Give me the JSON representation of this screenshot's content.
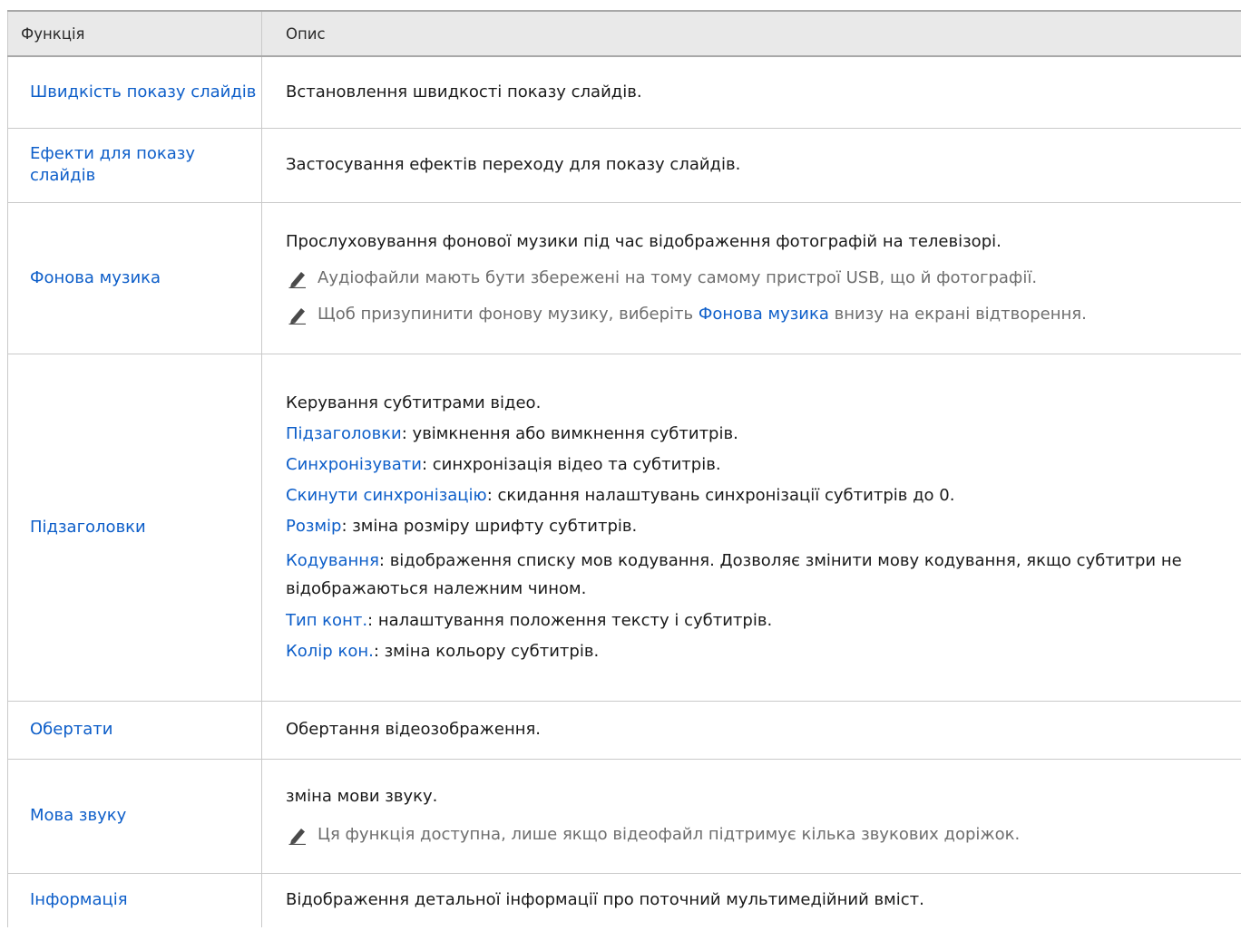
{
  "header": {
    "col_function": "Функція",
    "col_description": "Опис"
  },
  "rows": [
    {
      "function": "Швидкість показу слайдів",
      "desc": "Встановлення швидкості показу слайдів."
    },
    {
      "function": "Ефекти для показу слайдів",
      "desc": "Застосування ефектів переходу для показу слайдів."
    },
    {
      "function": "Фонова музика",
      "desc": "Прослуховування фонової музики під час відображення фотографій на телевізорі.",
      "note1": "Аудіофайли мають бути збережені на тому самому пристрої USB, що й фотографії.",
      "note2_before": "Щоб призупинити фонову музику, виберіть ",
      "note2_link": "Фонова музика",
      "note2_after": " внизу на екрані відтворення."
    },
    {
      "function": "Підзаголовки",
      "desc": "Керування субтитрами відео.",
      "items": [
        {
          "term": "Підзаголовки",
          "text": ": увімкнення або вимкнення субтитрів."
        },
        {
          "term": "Синхронізувати",
          "text": ": синхронізація відео та субтитрів."
        },
        {
          "term": "Скинути синхронізацію",
          "text": ": скидання налаштувань синхронізації субтитрів до 0."
        },
        {
          "term": "Розмір",
          "text": ": зміна розміру шрифту субтитрів."
        },
        {
          "term": "Кодування",
          "text": ": відображення списку мов кодування. Дозволяє змінити мову кодування, якщо субтитри не відображаються належним чином."
        },
        {
          "term": "Тип конт.",
          "text": ": налаштування положення тексту і субтитрів."
        },
        {
          "term": "Колір кон.",
          "text": ": зміна кольору субтитрів."
        }
      ]
    },
    {
      "function": "Обертати",
      "desc": "Обертання відеозображення."
    },
    {
      "function": "Мова звуку",
      "desc": "зміна мови звуку.",
      "note1": "Ця функція доступна, лише якщо відеофайл підтримує кілька звукових доріжок."
    },
    {
      "function": "Інформація",
      "desc": "Відображення детальної інформації про поточний мультимедійний вміст."
    }
  ],
  "colors": {
    "link": "#0d5ec9",
    "note": "#6e6e6e",
    "header_bg": "#e9e9e9"
  },
  "icons": {
    "note": "pencil-icon"
  }
}
